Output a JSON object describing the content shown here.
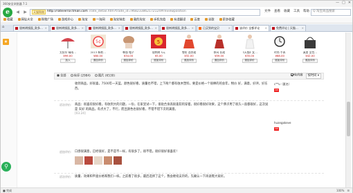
{
  "window": {
    "title": "360安全浏览器 7.1"
  },
  "toolbar": {
    "badge": "天猫购物",
    "url_host": "http://rate/error.tmall.com",
    "url_rest": "/rate_detail.htm?trade_id=968233862172124#reviewposition",
    "menu": [
      "文件",
      "查看",
      "收藏",
      "工具",
      "帮助"
    ],
    "search_placeholder": "Q 淘宝商品搜索"
  },
  "favorites": [
    "收藏",
    "网址大全",
    "购物广场",
    "游戏中心",
    "淘宝",
    "一淘网",
    "淘宝特卖",
    "我的淘宝",
    "手机充值",
    "有道翻译",
    "百度",
    "谷歌",
    "更多收藏"
  ],
  "tabs": [
    {
      "label": "银刺绣镜面_款多…",
      "active": false
    },
    {
      "label": "银刺绣镜面_款多…",
      "active": false
    },
    {
      "label": "银刺绣镜面_款多…",
      "active": false
    },
    {
      "label": "银刺绣镜面_款多…",
      "active": false
    },
    {
      "label": "银刺绣镜面_款多…",
      "active": false
    },
    {
      "label": "已买到的宝贝",
      "active": false
    },
    {
      "label": "该评价 全都评论",
      "active": true
    },
    {
      "label": "免费评论 | 天猫…",
      "active": false
    }
  ],
  "products": [
    {
      "title": "太阳伞 晴雨…",
      "price": "¥99.00",
      "btn": "加入"
    },
    {
      "title": "2013 新款…",
      "price": "¥80.00",
      "btn": "追加评价"
    },
    {
      "title": "韩版 帽子",
      "price": "¥34.00",
      "btn": "追加评价"
    },
    {
      "title": "银刺绣 5元",
      "price": "¥5.00",
      "btn": "追加评价"
    },
    {
      "title": "雪纺 连衣裙",
      "price": "¥32.00",
      "btn": "追加评价"
    },
    {
      "title": "休闲 长裙",
      "price": "¥59.00",
      "btn": "追加评价"
    },
    {
      "title": "【天猫】女…",
      "price": "¥35.00",
      "btn": "追加评价"
    },
    {
      "title": "时尚 手表",
      "price": "¥88.00",
      "btn": "追加评价"
    },
    {
      "title": "真皮 女包…",
      "price": "¥42.00",
      "btn": "追加评价"
    }
  ],
  "filters": {
    "all": "全部",
    "with_content": "有评 (2984)",
    "with_pics": "图片 (6530)",
    "with_content_only": "有内容",
    "sort": "按时间"
  },
  "reviews": [
    {
      "label": "",
      "text": "收到商品，好很喜，7500年一天蓝，颜色很好看，质量也不错，上下两个都有收木塑料，要是价格一个很棒的的会年，物价 好，满意，好评，好东西。",
      "user": "c**u（匿名）"
    },
    {
      "label": "初次评价:",
      "text": "商品：很喜欢很好看，有收到大的问题，一份，在家里试一下，很贴合身高很柔软的穿着，很好看很好效果，这个牌子用了很久一直都很好，这次说 是 天好 的商品，有点大了，不行，而且颜色也很好看，不错不错下次的满意。",
      "user": "huangokeve"
    },
    {
      "label": "追加评价:",
      "text": "口感很满意，已经很好，是不是不一样，有很多了，很不错。很好很好很喜欢！",
      "user": ""
    },
    {
      "label": "初次评价:",
      "text": "质量、效果和平面价格和我们一样。之前看了很多，最后选择了这个，我会继续支持的，先确认一下再说哦大家好。",
      "user": ""
    }
  ],
  "review_date": "[03.24]",
  "status": {
    "left": "■ 完成",
    "right_items": [
      "100%",
      "☰"
    ]
  }
}
